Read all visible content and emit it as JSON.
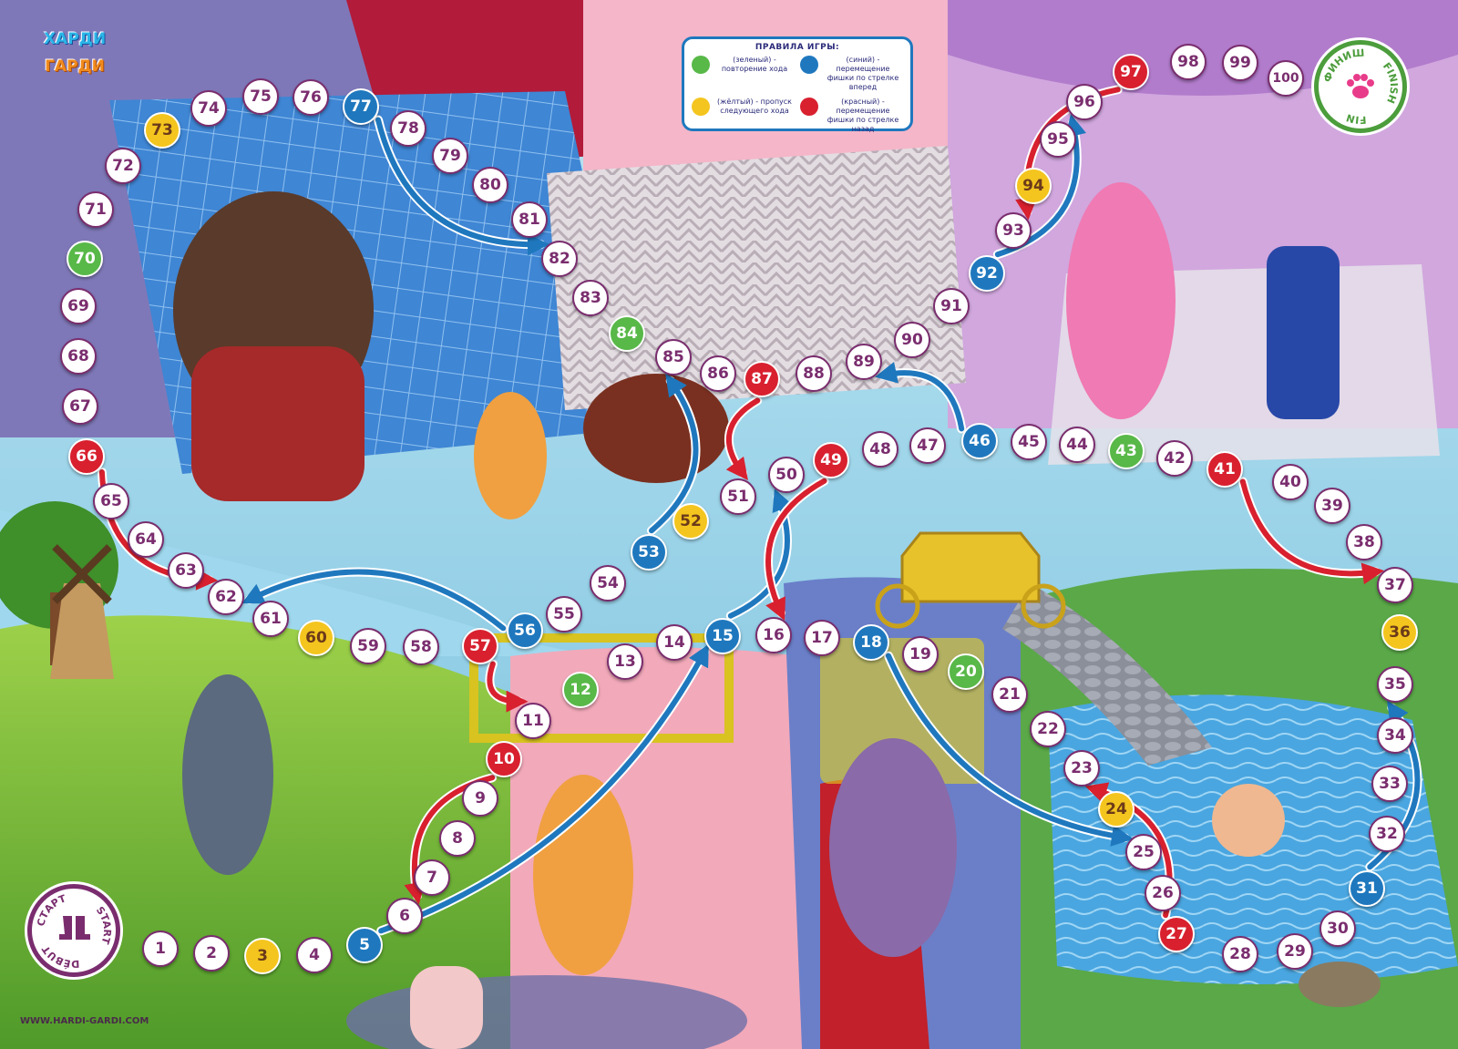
{
  "brand": {
    "logo_line1": "ХАРДИ",
    "logo_line2": "ГАРДИ",
    "website": "WWW.HARDI-GARDI.COM"
  },
  "finish": {
    "label_ru": "ФИНИШ",
    "label_en": "FINISH",
    "label_fr": "FIN",
    "icon": "paw-icon"
  },
  "start": {
    "label_ru": "СТАРТ",
    "label_en": "START",
    "label_fr": "DÉBUT",
    "icon": "boots-icon"
  },
  "rules": {
    "title": "ПРАВИЛА ИГРЫ:",
    "items": [
      {
        "color": "#58b848",
        "text": "(зеленый) - повторение хода"
      },
      {
        "color": "#1f78be",
        "text": "(синий) - перемещение фишки по стрелке вперед"
      },
      {
        "color": "#f4c51e",
        "text": "(жёлтый) - пропуск следующего хода"
      },
      {
        "color": "#d8202f",
        "text": "(красный) - перемещение фишки по стрелке назад"
      }
    ]
  },
  "colors": {
    "green": "#58b848",
    "yellow": "#f4c51e",
    "blue": "#1f78be",
    "red": "#d8202f",
    "number": "#7a2d6e"
  },
  "cells": [
    {
      "n": "1",
      "color": "white"
    },
    {
      "n": "2",
      "color": "white"
    },
    {
      "n": "3",
      "color": "yellow"
    },
    {
      "n": "4",
      "color": "white"
    },
    {
      "n": "5",
      "color": "blue"
    },
    {
      "n": "6",
      "color": "white"
    },
    {
      "n": "7",
      "color": "white"
    },
    {
      "n": "8",
      "color": "white"
    },
    {
      "n": "9",
      "color": "white"
    },
    {
      "n": "10",
      "color": "red"
    },
    {
      "n": "11",
      "color": "white"
    },
    {
      "n": "12",
      "color": "green"
    },
    {
      "n": "13",
      "color": "white"
    },
    {
      "n": "14",
      "color": "white"
    },
    {
      "n": "15",
      "color": "blue"
    },
    {
      "n": "16",
      "color": "white"
    },
    {
      "n": "17",
      "color": "white"
    },
    {
      "n": "18",
      "color": "blue"
    },
    {
      "n": "19",
      "color": "white"
    },
    {
      "n": "20",
      "color": "green"
    },
    {
      "n": "21",
      "color": "white"
    },
    {
      "n": "22",
      "color": "white"
    },
    {
      "n": "23",
      "color": "white"
    },
    {
      "n": "24",
      "color": "yellow"
    },
    {
      "n": "25",
      "color": "white"
    },
    {
      "n": "26",
      "color": "white"
    },
    {
      "n": "27",
      "color": "red"
    },
    {
      "n": "28",
      "color": "white"
    },
    {
      "n": "29",
      "color": "white"
    },
    {
      "n": "30",
      "color": "white"
    },
    {
      "n": "31",
      "color": "blue"
    },
    {
      "n": "32",
      "color": "white"
    },
    {
      "n": "33",
      "color": "white"
    },
    {
      "n": "34",
      "color": "white"
    },
    {
      "n": "35",
      "color": "white"
    },
    {
      "n": "36",
      "color": "yellow"
    },
    {
      "n": "37",
      "color": "white"
    },
    {
      "n": "38",
      "color": "white"
    },
    {
      "n": "39",
      "color": "white"
    },
    {
      "n": "40",
      "color": "white"
    },
    {
      "n": "41",
      "color": "red"
    },
    {
      "n": "42",
      "color": "white"
    },
    {
      "n": "43",
      "color": "green"
    },
    {
      "n": "44",
      "color": "white"
    },
    {
      "n": "45",
      "color": "white"
    },
    {
      "n": "46",
      "color": "blue"
    },
    {
      "n": "47",
      "color": "white"
    },
    {
      "n": "48",
      "color": "white"
    },
    {
      "n": "49",
      "color": "red"
    },
    {
      "n": "50",
      "color": "white"
    },
    {
      "n": "51",
      "color": "white"
    },
    {
      "n": "52",
      "color": "yellow"
    },
    {
      "n": "53",
      "color": "blue"
    },
    {
      "n": "54",
      "color": "white"
    },
    {
      "n": "55",
      "color": "white"
    },
    {
      "n": "56",
      "color": "blue"
    },
    {
      "n": "57",
      "color": "red"
    },
    {
      "n": "58",
      "color": "white"
    },
    {
      "n": "59",
      "color": "white"
    },
    {
      "n": "60",
      "color": "yellow"
    },
    {
      "n": "61",
      "color": "white"
    },
    {
      "n": "62",
      "color": "white"
    },
    {
      "n": "63",
      "color": "white"
    },
    {
      "n": "64",
      "color": "white"
    },
    {
      "n": "65",
      "color": "white"
    },
    {
      "n": "66",
      "color": "red"
    },
    {
      "n": "67",
      "color": "white"
    },
    {
      "n": "68",
      "color": "white"
    },
    {
      "n": "69",
      "color": "white"
    },
    {
      "n": "70",
      "color": "green"
    },
    {
      "n": "71",
      "color": "white"
    },
    {
      "n": "72",
      "color": "white"
    },
    {
      "n": "73",
      "color": "yellow"
    },
    {
      "n": "74",
      "color": "white"
    },
    {
      "n": "75",
      "color": "white"
    },
    {
      "n": "76",
      "color": "white"
    },
    {
      "n": "77",
      "color": "blue"
    },
    {
      "n": "78",
      "color": "white"
    },
    {
      "n": "79",
      "color": "white"
    },
    {
      "n": "80",
      "color": "white"
    },
    {
      "n": "81",
      "color": "white"
    },
    {
      "n": "82",
      "color": "white"
    },
    {
      "n": "83",
      "color": "white"
    },
    {
      "n": "84",
      "color": "green"
    },
    {
      "n": "85",
      "color": "white"
    },
    {
      "n": "86",
      "color": "white"
    },
    {
      "n": "87",
      "color": "red"
    },
    {
      "n": "88",
      "color": "white"
    },
    {
      "n": "89",
      "color": "white"
    },
    {
      "n": "90",
      "color": "white"
    },
    {
      "n": "91",
      "color": "white"
    },
    {
      "n": "92",
      "color": "blue"
    },
    {
      "n": "93",
      "color": "white"
    },
    {
      "n": "94",
      "color": "yellow"
    },
    {
      "n": "95",
      "color": "white"
    },
    {
      "n": "96",
      "color": "white"
    },
    {
      "n": "97",
      "color": "red"
    },
    {
      "n": "98",
      "color": "white"
    },
    {
      "n": "99",
      "color": "white"
    },
    {
      "n": "100",
      "color": "white"
    }
  ],
  "jumps": [
    {
      "from": "5",
      "to": "15",
      "color": "blue"
    },
    {
      "from": "10",
      "to": "6",
      "color": "red"
    },
    {
      "from": "15",
      "to": "50",
      "color": "blue"
    },
    {
      "from": "18",
      "to": "25",
      "color": "blue"
    },
    {
      "from": "27",
      "to": "23",
      "color": "red"
    },
    {
      "from": "31",
      "to": "35",
      "color": "blue"
    },
    {
      "from": "41",
      "to": "37",
      "color": "red"
    },
    {
      "from": "46",
      "to": "89",
      "color": "blue"
    },
    {
      "from": "49",
      "to": "16",
      "color": "red"
    },
    {
      "from": "53",
      "to": "85",
      "color": "blue"
    },
    {
      "from": "56",
      "to": "62",
      "color": "blue"
    },
    {
      "from": "57",
      "to": "11",
      "color": "red"
    },
    {
      "from": "66",
      "to": "62",
      "color": "red"
    },
    {
      "from": "77",
      "to": "82",
      "color": "blue"
    },
    {
      "from": "87",
      "to": "51",
      "color": "red"
    },
    {
      "from": "92",
      "to": "96",
      "color": "blue"
    },
    {
      "from": "97",
      "to": "93",
      "color": "red"
    }
  ]
}
